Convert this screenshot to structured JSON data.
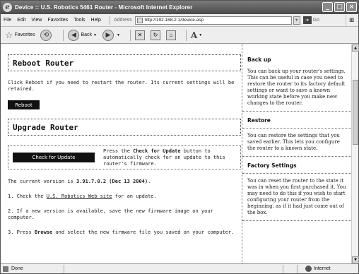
{
  "window": {
    "title": "Device :: U.S. Robotics 5461 Router - Microsoft Internet Explorer",
    "buttons": [
      "_",
      "□",
      "×"
    ]
  },
  "menu": {
    "items": [
      "File",
      "Edit",
      "View",
      "Favorites",
      "Tools",
      "Help"
    ],
    "address_label": "Address",
    "address_value": "http://192.168.2.1/device.asp",
    "go_label": "Go"
  },
  "toolbar": {
    "favorites": "Favorites",
    "back": "Back"
  },
  "main": {
    "reboot_heading": "Reboot Router",
    "reboot_text": "Click Reboot if you need to restart the router. Its current settings will be retained.",
    "reboot_button": "Reboot",
    "upgrade_heading": "Upgrade Router",
    "check_button": "Check for Update",
    "check_text_pre": "Press the ",
    "check_text_bold": "Check for Update",
    "check_text_post": " button to automatically check for an update to this router's firmware.",
    "version_pre": "The current version is ",
    "version_value": "3.91.7.0.2 (Dec 13 2004)",
    "version_post": ".",
    "step1_pre": "1. Check the ",
    "step1_link": "U.S. Robotics Web site",
    "step1_post": " for an update.",
    "step2": "2. If a new version is available, save the new firmware image on your computer.",
    "step3_pre": "3. Press ",
    "step3_bold": "Browse",
    "step3_post": " and select the new firmware file you saved on your computer."
  },
  "help": {
    "backup_title": "Back up",
    "backup_text": "You can back up your router's settings. This can be useful in case you need to restore the router to its factory default settings or want to save a known working state before you make new changes to the router.",
    "restore_title": "Restore",
    "restore_text": "You can restore the settings that you saved earlier. This lets you configure the router to a known state.",
    "factory_title": "Factory Settings",
    "factory_text": "You can reset the router to the state it was in when you first purchased it. You may need to do this if you wish to start configuring your router from the beginning, as if it had just come out of the box."
  },
  "status": {
    "left": "Done",
    "zone": "Internet"
  }
}
